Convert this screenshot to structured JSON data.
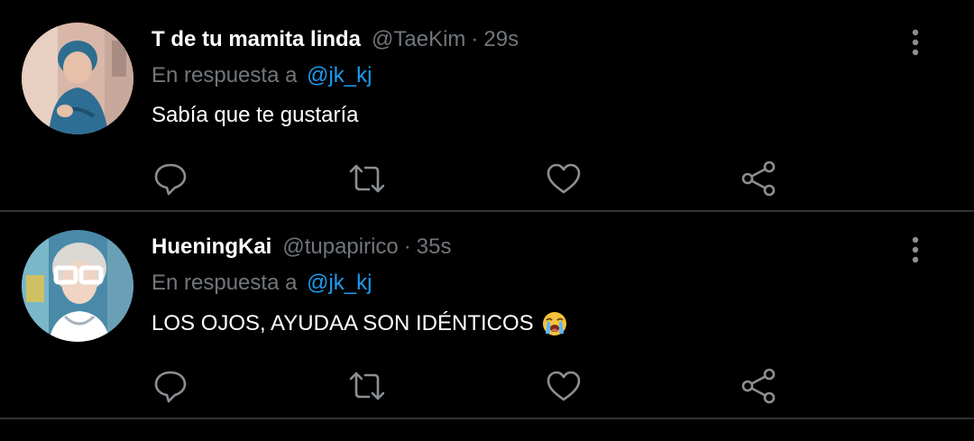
{
  "tweets": [
    {
      "display_name": "T de tu mamita linda",
      "handle": "@TaeKim",
      "separator": "·",
      "time": "29s",
      "reply_prefix": "En respuesta a",
      "reply_to": "@jk_kj",
      "text": "Sabía que te gustaría",
      "emoji": ""
    },
    {
      "display_name": "HueningKai",
      "handle": "@tupapirico",
      "separator": "·",
      "time": "35s",
      "reply_prefix": "En respuesta a",
      "reply_to": "@jk_kj",
      "text": "LOS OJOS, AYUDAA SON IDÉNTICOS",
      "emoji": "loudly-crying-face"
    }
  ],
  "icons": [
    "comment-icon",
    "retweet-icon",
    "like-icon",
    "share-icon",
    "more-vertical-icon"
  ],
  "colors": {
    "background": "#000000",
    "secondary_text": "#71767b",
    "mention": "#1d9bf0",
    "divider": "#2f3336"
  }
}
